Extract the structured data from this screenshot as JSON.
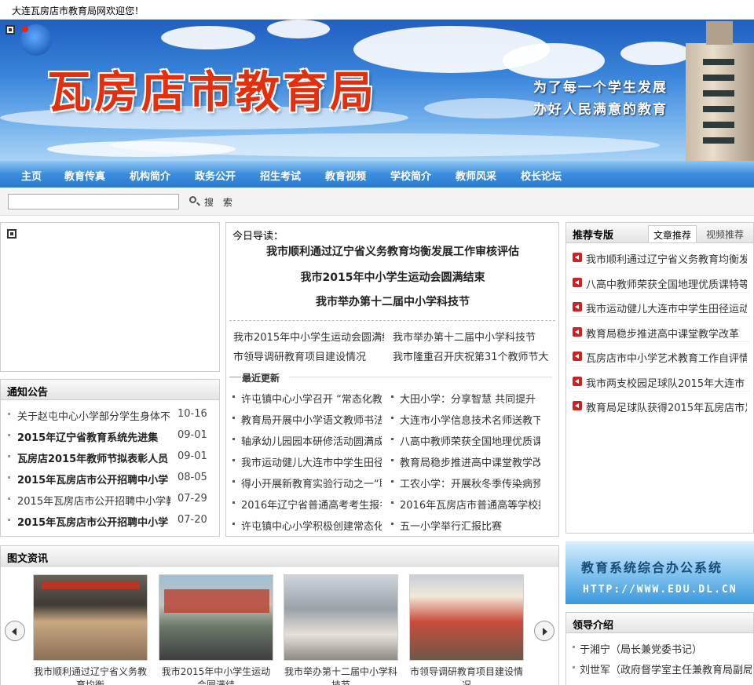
{
  "topbar": {
    "welcome": "大连瓦房店市教育局网欢迎您！"
  },
  "banner": {
    "title": "瓦房店市教育局",
    "slogan1": "为了每一个学生发展",
    "slogan2": "办好人民满意的教育"
  },
  "nav": [
    "主页",
    "教育传真",
    "机构简介",
    "政务公开",
    "招生考试",
    "教育视频",
    "学校简介",
    "教师风采",
    "校长论坛"
  ],
  "search": {
    "placeholder": "",
    "button": "搜 索"
  },
  "notices": {
    "title": "通知公告",
    "items": [
      {
        "title": "关于赵屯中心小学部分学生身体不适",
        "date": "10-16",
        "bold": false
      },
      {
        "title": "2015年辽宁省教育系统先进集",
        "date": "09-01",
        "bold": true
      },
      {
        "title": "瓦房店2015年教师节拟表彰人员",
        "date": "09-01",
        "bold": true
      },
      {
        "title": "2015年瓦房店市公开招聘中小学",
        "date": "08-05",
        "bold": true
      },
      {
        "title": "2015年瓦房店市公开招聘中小学教",
        "date": "07-29",
        "bold": false
      },
      {
        "title": "2015年瓦房店市公开招聘中小学",
        "date": "07-20",
        "bold": true
      }
    ]
  },
  "today": {
    "label": "今日导读：",
    "headlines": [
      "我市顺利通过辽宁省义务教育均衡发展工作审核评估",
      "我市2015年中小学生运动会圆满结束",
      "我市举办第十二届中小学科技节"
    ],
    "links": [
      "我市2015年中小学生运动会圆满结",
      "我市举办第十二届中小学科技节",
      "市领导调研教育项目建设情况",
      "我市隆重召开庆祝第31个教师节大"
    ],
    "updates_title": "最近更新",
    "updates": [
      "许屯镇中心小学召开 “常态化教研",
      "大田小学：分享智慧 共同提升",
      "教育局开展中小学语文教师书法培",
      "大连市小学信息技术名师送教下乡",
      "轴承幼儿园园本研修活动圆满成功",
      "八高中教师荣获全国地理优质课特",
      "我市运动健儿大连市中学生田径运",
      "教育局稳步推进高中课堂教学改革",
      "得小开展新教育实验行动之一“聆",
      "工农小学：开展秋冬季传染病预防",
      "2016年辽宁省普通高考考生报名",
      "2016年瓦房店市普通高等学校招",
      "许屯镇中心小学积极创建常态化教",
      "五一小学举行汇报比赛"
    ]
  },
  "recommend": {
    "title": "推荐专版",
    "tab1": "文章推荐",
    "tab2": "视频推荐",
    "items": [
      "我市顺利通过辽宁省义务教育均衡发展",
      "八高中教师荣获全国地理优质课特等奖",
      "我市运动健儿大连市中学生田径运动会",
      "教育局稳步推进高中课堂教学改革",
      "瓦房店市中小学艺术教育工作自评情况",
      "我市两支校园足球队2015年大连市",
      "教育局足球队获得2015年瓦房店市足"
    ]
  },
  "photos": {
    "title": "图文资讯",
    "items": [
      {
        "caption": "我市顺利通过辽宁省义务教育均衡"
      },
      {
        "caption": "我市2015年中小学生运动会圆满结"
      },
      {
        "caption": "我市举办第十二届中小学科技节"
      },
      {
        "caption": "市领导调研教育项目建设情况"
      }
    ]
  },
  "oa": {
    "line1": "教育系统综合办公系统",
    "line2": "HTTP://WWW.EDU.DL.CN"
  },
  "leaders": {
    "title": "领导介绍",
    "items": [
      "于湘宁（局长兼党委书记）",
      "刘世军（政府督学室主任兼教育局副局"
    ]
  },
  "colors": {
    "nav": "#2b7bcf",
    "banner_title": "#e03010",
    "accent_red": "#cc2222"
  }
}
